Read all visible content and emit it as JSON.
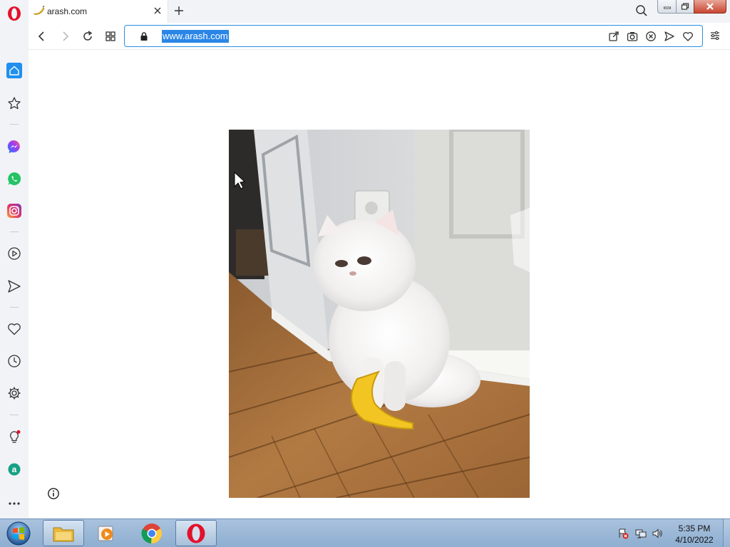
{
  "tab": {
    "title": "arash.com",
    "favicon": "banana-icon"
  },
  "address_bar": {
    "url": "www.arash.com"
  },
  "toolbar": {
    "icons": [
      "back-icon",
      "forward-icon",
      "reload-icon",
      "tabs-grid-icon",
      "share-icon",
      "snapshot-icon",
      "adblock-icon",
      "send-icon",
      "heart-icon",
      "easy-setup-icon"
    ]
  },
  "sidebar": {
    "items": [
      "home-icon",
      "bookmarks-icon",
      "messenger-icon",
      "whatsapp-icon",
      "instagram-icon",
      "player-icon",
      "flow-icon",
      "pinboard-icon",
      "history-icon",
      "settings-icon",
      "tips-icon",
      "aria-icon",
      "more-icon"
    ]
  },
  "content": {
    "image": "white persian cat sitting on wooden floor next to a yellow banana toy"
  },
  "taskbar": {
    "apps": [
      "explorer",
      "media-player",
      "chrome",
      "opera"
    ],
    "clock_time": "5:35 PM",
    "clock_date": "4/10/2022"
  },
  "colors": {
    "accent": "#2a86e6",
    "opera_red": "#e3122c"
  }
}
